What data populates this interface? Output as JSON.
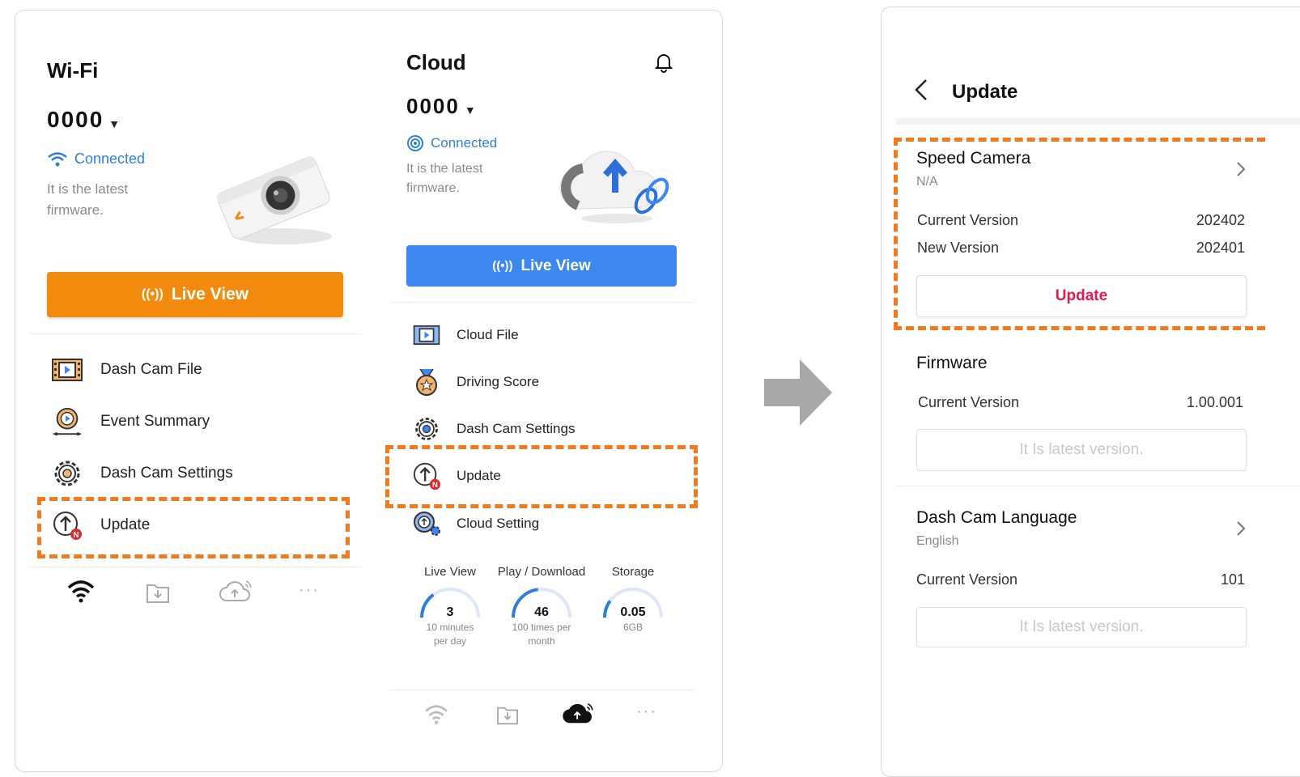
{
  "left_panel": {
    "wifi": {
      "title": "Wi-Fi",
      "device_id": "0000",
      "status": "Connected",
      "firmware_line1": "It is the latest",
      "firmware_line2": "firmware.",
      "live_view": "Live View",
      "menu": [
        {
          "label": "Dash Cam File",
          "icon": "film-icon"
        },
        {
          "label": "Event Summary",
          "icon": "event-summary-icon"
        },
        {
          "label": "Dash Cam Settings",
          "icon": "gear-icon"
        },
        {
          "label": "Update",
          "icon": "update-icon",
          "badge": "N"
        }
      ],
      "bottom_nav": [
        "wifi-icon",
        "download-folder-icon",
        "cloud-upload-icon",
        "more-icon"
      ]
    },
    "cloud": {
      "title": "Cloud",
      "device_id": "0000",
      "status": "Connected",
      "firmware_line1": "It is the latest",
      "firmware_line2": "firmware.",
      "live_view": "Live View",
      "menu": [
        {
          "label": "Cloud File",
          "icon": "film-icon"
        },
        {
          "label": "Driving Score",
          "icon": "medal-icon"
        },
        {
          "label": "Dash Cam Settings",
          "icon": "gear-icon"
        },
        {
          "label": "Update",
          "icon": "update-icon",
          "badge": "N"
        },
        {
          "label": "Cloud Setting",
          "icon": "cloud-setting-icon"
        }
      ],
      "stats": [
        {
          "title": "Live View",
          "value": "3",
          "sub1": "10 minutes",
          "sub2": "per day",
          "fill": 0.3
        },
        {
          "title": "Play / Download",
          "value": "46",
          "sub1": "100 times per",
          "sub2": "month",
          "fill": 0.46
        },
        {
          "title": "Storage",
          "value": "0.05",
          "sub1": "6GB",
          "sub2": "",
          "fill": 0.2
        }
      ],
      "bottom_nav": [
        "wifi-icon",
        "download-folder-icon",
        "cloud-upload-icon",
        "more-icon"
      ]
    }
  },
  "right_panel": {
    "title": "Update",
    "speed_camera": {
      "title": "Speed Camera",
      "sub": "N/A",
      "current_label": "Current Version",
      "current_value": "202402",
      "new_label": "New Version",
      "new_value": "202401",
      "button": "Update"
    },
    "firmware": {
      "title": "Firmware",
      "current_label": "Current Version",
      "current_value": "1.00.001",
      "button": "It Is latest version."
    },
    "language": {
      "title": "Dash Cam Language",
      "sub": "English",
      "current_label": "Current Version",
      "current_value": "101",
      "button": "It Is latest version."
    }
  },
  "colors": {
    "orange": "#f28a0e",
    "blue": "#3c87f0",
    "accent_red": "#e6194b",
    "dash": "#f07a1c"
  }
}
